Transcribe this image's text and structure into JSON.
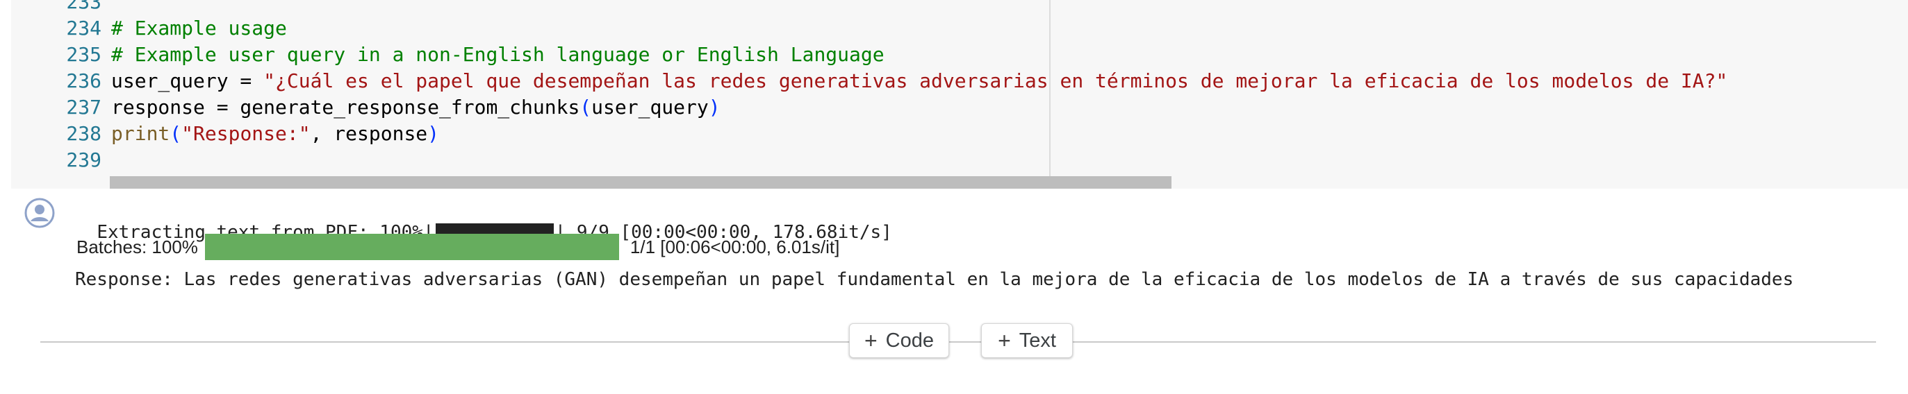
{
  "code": {
    "lines": [
      {
        "num": "233",
        "parts": []
      },
      {
        "num": "234",
        "parts": [
          {
            "cls": "c",
            "text": "# Example usage"
          }
        ]
      },
      {
        "num": "235",
        "parts": [
          {
            "cls": "c",
            "text": "# Example user query in a non-English language or English Language"
          }
        ]
      },
      {
        "num": "236",
        "parts": [
          {
            "cls": "",
            "text": "user_query = "
          },
          {
            "cls": "s",
            "text": "\"¿Cuál es el papel que desempeñan las redes generativas adversarias en términos de mejorar la eficacia de los modelos de IA?\""
          }
        ]
      },
      {
        "num": "237",
        "parts": [
          {
            "cls": "",
            "text": "response = generate_response_from_chunks"
          },
          {
            "cls": "p",
            "text": "("
          },
          {
            "cls": "",
            "text": "user_query"
          },
          {
            "cls": "p",
            "text": ")"
          }
        ]
      },
      {
        "num": "238",
        "parts": [
          {
            "cls": "fn",
            "text": "print"
          },
          {
            "cls": "p",
            "text": "("
          },
          {
            "cls": "s",
            "text": "\"Response:\""
          },
          {
            "cls": "",
            "text": ", response"
          },
          {
            "cls": "p",
            "text": ")"
          }
        ]
      },
      {
        "num": "239",
        "parts": []
      }
    ]
  },
  "output": {
    "icon": "account-circle-icon",
    "pdf_progress": {
      "prefix": "Extracting text from PDF: 100%|",
      "suffix": "| 9/9 [00:00<00:00, 178.68it/s]"
    },
    "batches": {
      "label": "Batches: 100%",
      "progress": 1.0,
      "stats": "1/1 [00:06<00:00,  6.01s/it]"
    },
    "response_text": "Response: Las redes generativas adversarias (GAN) desempeñan un papel fundamental en la mejora de la eficacia de los modelos de IA a través de sus capacidades"
  },
  "add_cell": {
    "code_label": "Code",
    "text_label": "Text"
  },
  "colors": {
    "progress_fill": "#66ad5e",
    "comment": "#008000",
    "string": "#a31515"
  }
}
